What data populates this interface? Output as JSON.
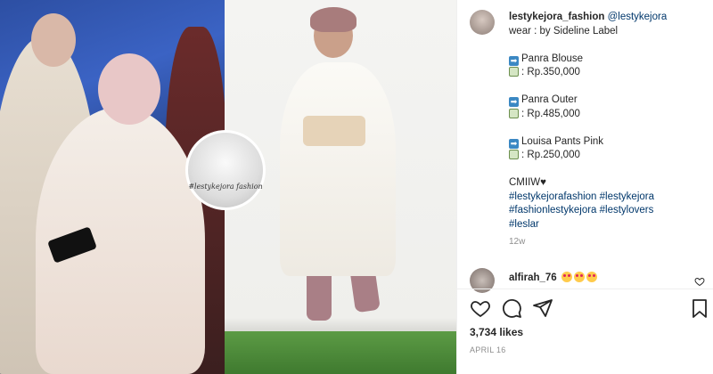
{
  "post": {
    "username": "lestykejora_fashion",
    "mention": "@lestykejora",
    "caption_lines": [
      "wear : by Sideline Label"
    ],
    "items": [
      {
        "name": "Panra Blouse",
        "price": ": Rp.350,000"
      },
      {
        "name": "Panra Outer",
        "price": ": Rp.485,000"
      },
      {
        "name": "Louisa Pants Pink",
        "price": ": Rp.250,000"
      }
    ],
    "cmiiw": "CMIIW",
    "heart": "♥",
    "hashtags": [
      "#lestykejorafashion #lestykejora",
      "#fashionlestykejora #lestylovers",
      "#leslar"
    ],
    "age": "12w"
  },
  "comment": {
    "username": "alfirah_76"
  },
  "stats": {
    "likes": "3,734 likes",
    "date": "APRIL 16"
  },
  "inset": {
    "watermark": "#lestykejora fashion"
  },
  "colors": {
    "link": "#00376b",
    "muted": "#8e8e8e",
    "icon_arrow": "#3b88c3"
  },
  "icons": [
    "heart-icon",
    "comment-icon",
    "share-icon",
    "bookmark-icon",
    "arrow-right-icon",
    "money-icon",
    "heart-eyes-emoji"
  ]
}
